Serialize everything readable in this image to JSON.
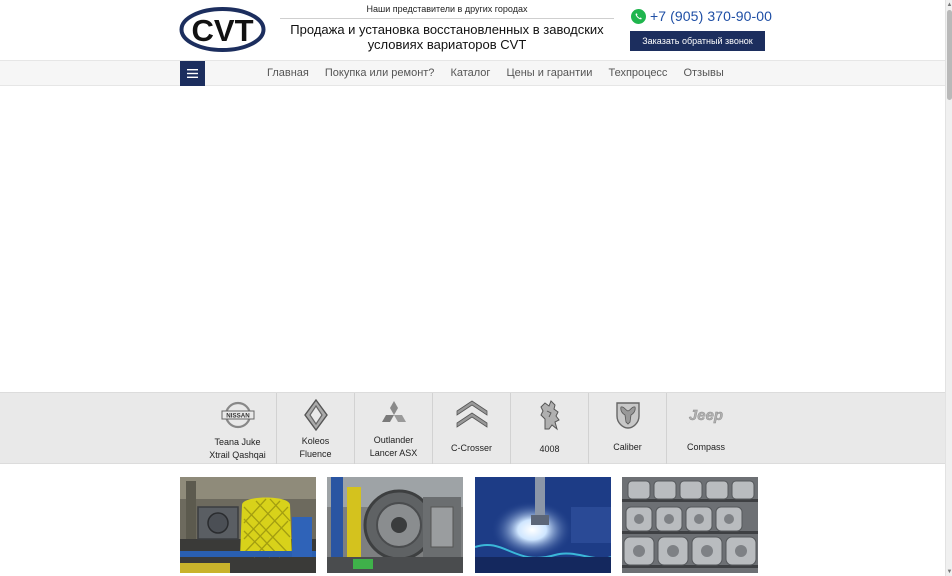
{
  "header": {
    "logo_text": "CVT",
    "regions_link": "Наши представители в других городах",
    "tagline": "Продажа и установка восстановленных в заводских условиях вариаторов CVT",
    "phone": "+7 (905) 370-90-00",
    "callback_button": "Заказать обратный звонок",
    "icons": {
      "messenger": "whatsapp-icon",
      "menu": "hamburger-menu-icon"
    },
    "colors": {
      "brand_navy": "#1c2e5e",
      "phone_blue": "#1f4fa5",
      "whatsapp_green": "#1fb54d"
    }
  },
  "nav": {
    "items": [
      {
        "label": "Главная"
      },
      {
        "label": "Покупка или ремонт?"
      },
      {
        "label": "Каталог"
      },
      {
        "label": "Цены и гарантии"
      },
      {
        "label": "Техпроцесс"
      },
      {
        "label": "Отзывы"
      }
    ]
  },
  "brands": [
    {
      "logo": "nissan-logo-icon",
      "line1": "Teana   Juke",
      "line2": "Xtrail Qashqai"
    },
    {
      "logo": "renault-logo-icon",
      "line1": "Koleos",
      "line2": "Fluence"
    },
    {
      "logo": "mitsubishi-logo-icon",
      "line1": "Outlander",
      "line2": "Lancer   ASX"
    },
    {
      "logo": "citroen-logo-icon",
      "line1": "C-Crosser",
      "line2": ""
    },
    {
      "logo": "peugeot-logo-icon",
      "line1": "4008",
      "line2": ""
    },
    {
      "logo": "dodge-logo-icon",
      "line1": "Caliber",
      "line2": ""
    },
    {
      "logo": "jeep-logo-icon",
      "line1": "Compass",
      "line2": "",
      "logo_text": "Jeep"
    }
  ],
  "cards": [
    {
      "image": "cvt-test-stand-photo"
    },
    {
      "image": "cvt-disassembly-photo"
    },
    {
      "image": "welding-photo"
    },
    {
      "image": "cvt-stock-shelves-photo"
    }
  ]
}
